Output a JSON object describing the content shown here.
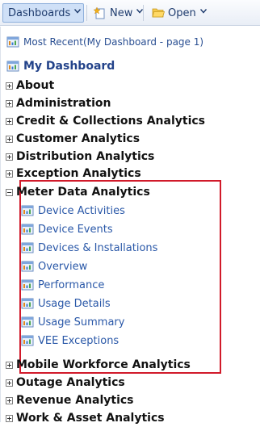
{
  "toolbar": {
    "dashboards_label": "Dashboards",
    "new_label": "New",
    "open_label": "Open"
  },
  "menu": {
    "most_recent": "Most Recent(My Dashboard - page 1)",
    "my_dashboard": "My Dashboard",
    "folders_before": [
      {
        "label": "About"
      },
      {
        "label": "Administration"
      },
      {
        "label": "Credit & Collections Analytics"
      },
      {
        "label": "Customer Analytics"
      },
      {
        "label": "Distribution Analytics"
      },
      {
        "label": "Exception Analytics"
      }
    ],
    "expanded_folder": {
      "label": "Meter Data Analytics",
      "items": [
        {
          "label": "Device Activities"
        },
        {
          "label": "Device Events"
        },
        {
          "label": "Devices & Installations"
        },
        {
          "label": "Overview"
        },
        {
          "label": "Performance"
        },
        {
          "label": "Usage Details"
        },
        {
          "label": "Usage Summary"
        },
        {
          "label": "VEE Exceptions"
        }
      ]
    },
    "folders_after": [
      {
        "label": "Mobile Workforce Analytics"
      },
      {
        "label": "Outage Analytics"
      },
      {
        "label": "Revenue Analytics"
      },
      {
        "label": "Work & Asset Analytics"
      }
    ]
  },
  "colors": {
    "highlight_border": "#d11a2a",
    "link": "#2a58a8",
    "toolbar_active": "#cfe0f7"
  },
  "icons": {
    "dashboard": "dashboard-icon",
    "new": "new-star-icon",
    "open": "folder-open-icon",
    "expand": "plus-box-icon",
    "collapse": "minus-box-icon",
    "dropdown": "chevron-down-icon"
  }
}
